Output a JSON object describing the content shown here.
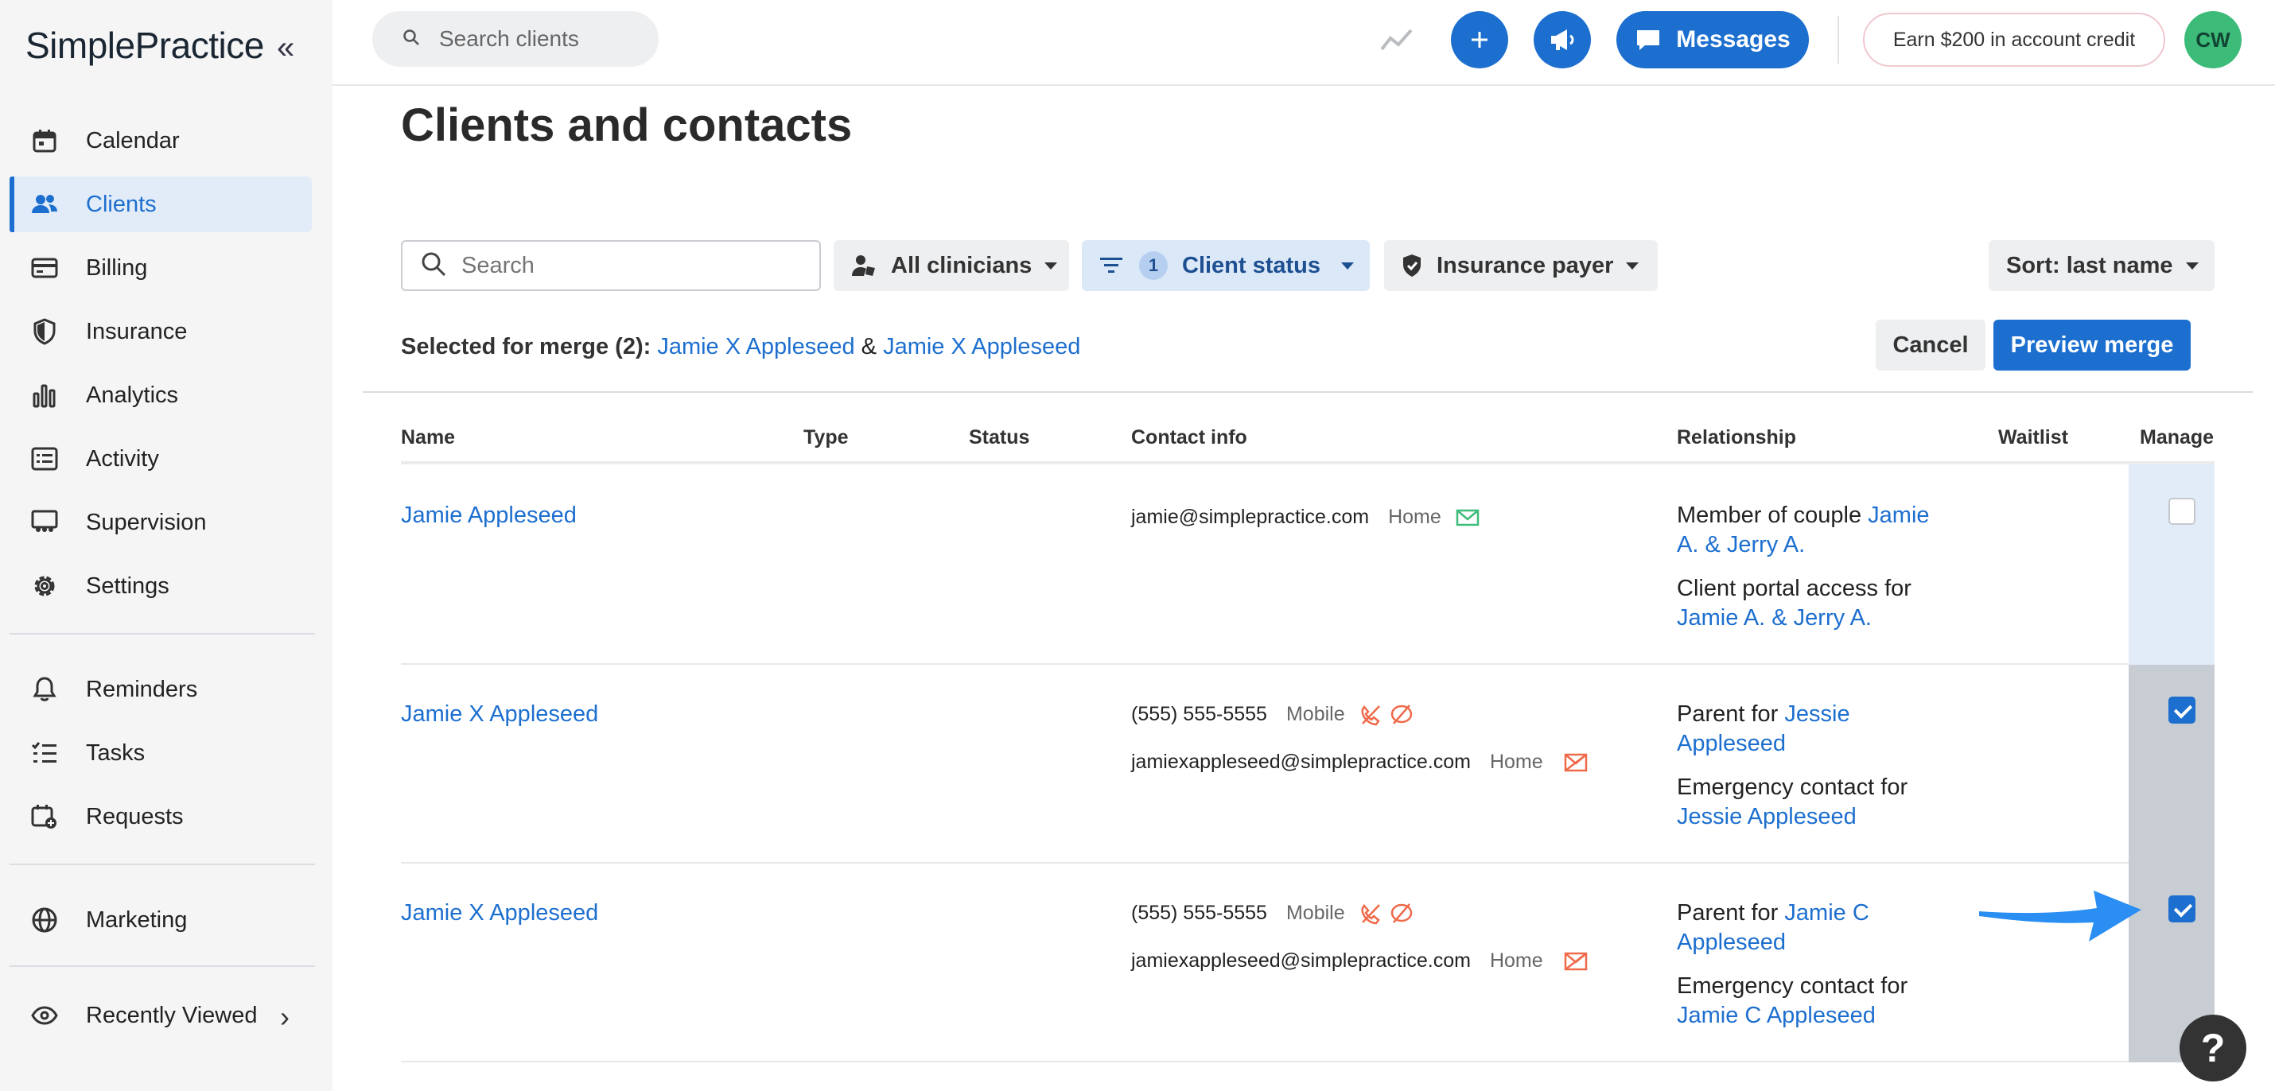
{
  "brand": {
    "name": "SimplePractice"
  },
  "sidebar": {
    "items": [
      {
        "label": "Calendar",
        "icon": "calendar-icon"
      },
      {
        "label": "Clients",
        "icon": "users-icon",
        "active": true
      },
      {
        "label": "Billing",
        "icon": "credit-card-icon"
      },
      {
        "label": "Insurance",
        "icon": "shield-icon"
      },
      {
        "label": "Analytics",
        "icon": "bar-chart-icon"
      },
      {
        "label": "Activity",
        "icon": "list-icon"
      },
      {
        "label": "Supervision",
        "icon": "supervision-icon"
      },
      {
        "label": "Settings",
        "icon": "gear-icon"
      },
      {
        "label": "Reminders",
        "icon": "bell-icon"
      },
      {
        "label": "Tasks",
        "icon": "tasks-icon"
      },
      {
        "label": "Requests",
        "icon": "calendar-plus-icon"
      },
      {
        "label": "Marketing",
        "icon": "globe-icon"
      },
      {
        "label": "Recently Viewed",
        "icon": "eye-icon"
      }
    ]
  },
  "topbar": {
    "search_placeholder": "Search clients",
    "messages_label": "Messages",
    "earn_label": "Earn $200 in account credit",
    "avatar_initials": "CW"
  },
  "page": {
    "title": "Clients and contacts",
    "search_placeholder": "Search",
    "filters": {
      "clinicians": "All clinicians",
      "status_count": "1",
      "status": "Client status",
      "insurance": "Insurance payer",
      "sort": "Sort: last name"
    },
    "merge": {
      "prefix": "Selected for merge (2):",
      "first": "Jamie X Appleseed",
      "joiner": "&",
      "second": "Jamie X Appleseed",
      "cancel": "Cancel",
      "preview": "Preview merge"
    },
    "columns": [
      "Name",
      "Type",
      "Status",
      "Contact info",
      "Relationship",
      "Waitlist",
      "Manage"
    ]
  },
  "rows": [
    {
      "name": "Jamie Appleseed",
      "contacts": [
        {
          "value": "jamie@simplepractice.com",
          "kind": "Home",
          "icons": [
            "mail-icon"
          ]
        }
      ],
      "relationships": [
        {
          "text": "Member of couple ",
          "link": "Jamie A. & Jerry A."
        },
        {
          "text": "Client portal access for ",
          "link": "Jamie A. & Jerry A."
        }
      ],
      "checked": false
    },
    {
      "name": "Jamie X Appleseed",
      "contacts": [
        {
          "value": "(555) 555-5555",
          "kind": "Mobile",
          "icons": [
            "phone-off-icon",
            "message-off-icon"
          ]
        },
        {
          "value": "jamiexappleseed@simplepractice.com",
          "kind": "Home",
          "icons": [
            "mail-off-icon"
          ]
        }
      ],
      "relationships": [
        {
          "text": "Parent for ",
          "link": "Jessie Appleseed"
        },
        {
          "text": "Emergency contact for ",
          "link": "Jessie Appleseed"
        }
      ],
      "checked": true
    },
    {
      "name": "Jamie X Appleseed",
      "contacts": [
        {
          "value": "(555) 555-5555",
          "kind": "Mobile",
          "icons": [
            "phone-off-icon",
            "message-off-icon"
          ]
        },
        {
          "value": "jamiexappleseed@simplepractice.com",
          "kind": "Home",
          "icons": [
            "mail-off-icon"
          ]
        }
      ],
      "relationships": [
        {
          "text": "Parent for ",
          "link": "Jamie C Appleseed"
        },
        {
          "text": "Emergency contact for ",
          "link": "Jamie C Appleseed"
        }
      ],
      "checked": true
    }
  ],
  "colors": {
    "accent": "#1d6fcf",
    "warning": "#ef6a4a",
    "success": "#3dbb79"
  }
}
